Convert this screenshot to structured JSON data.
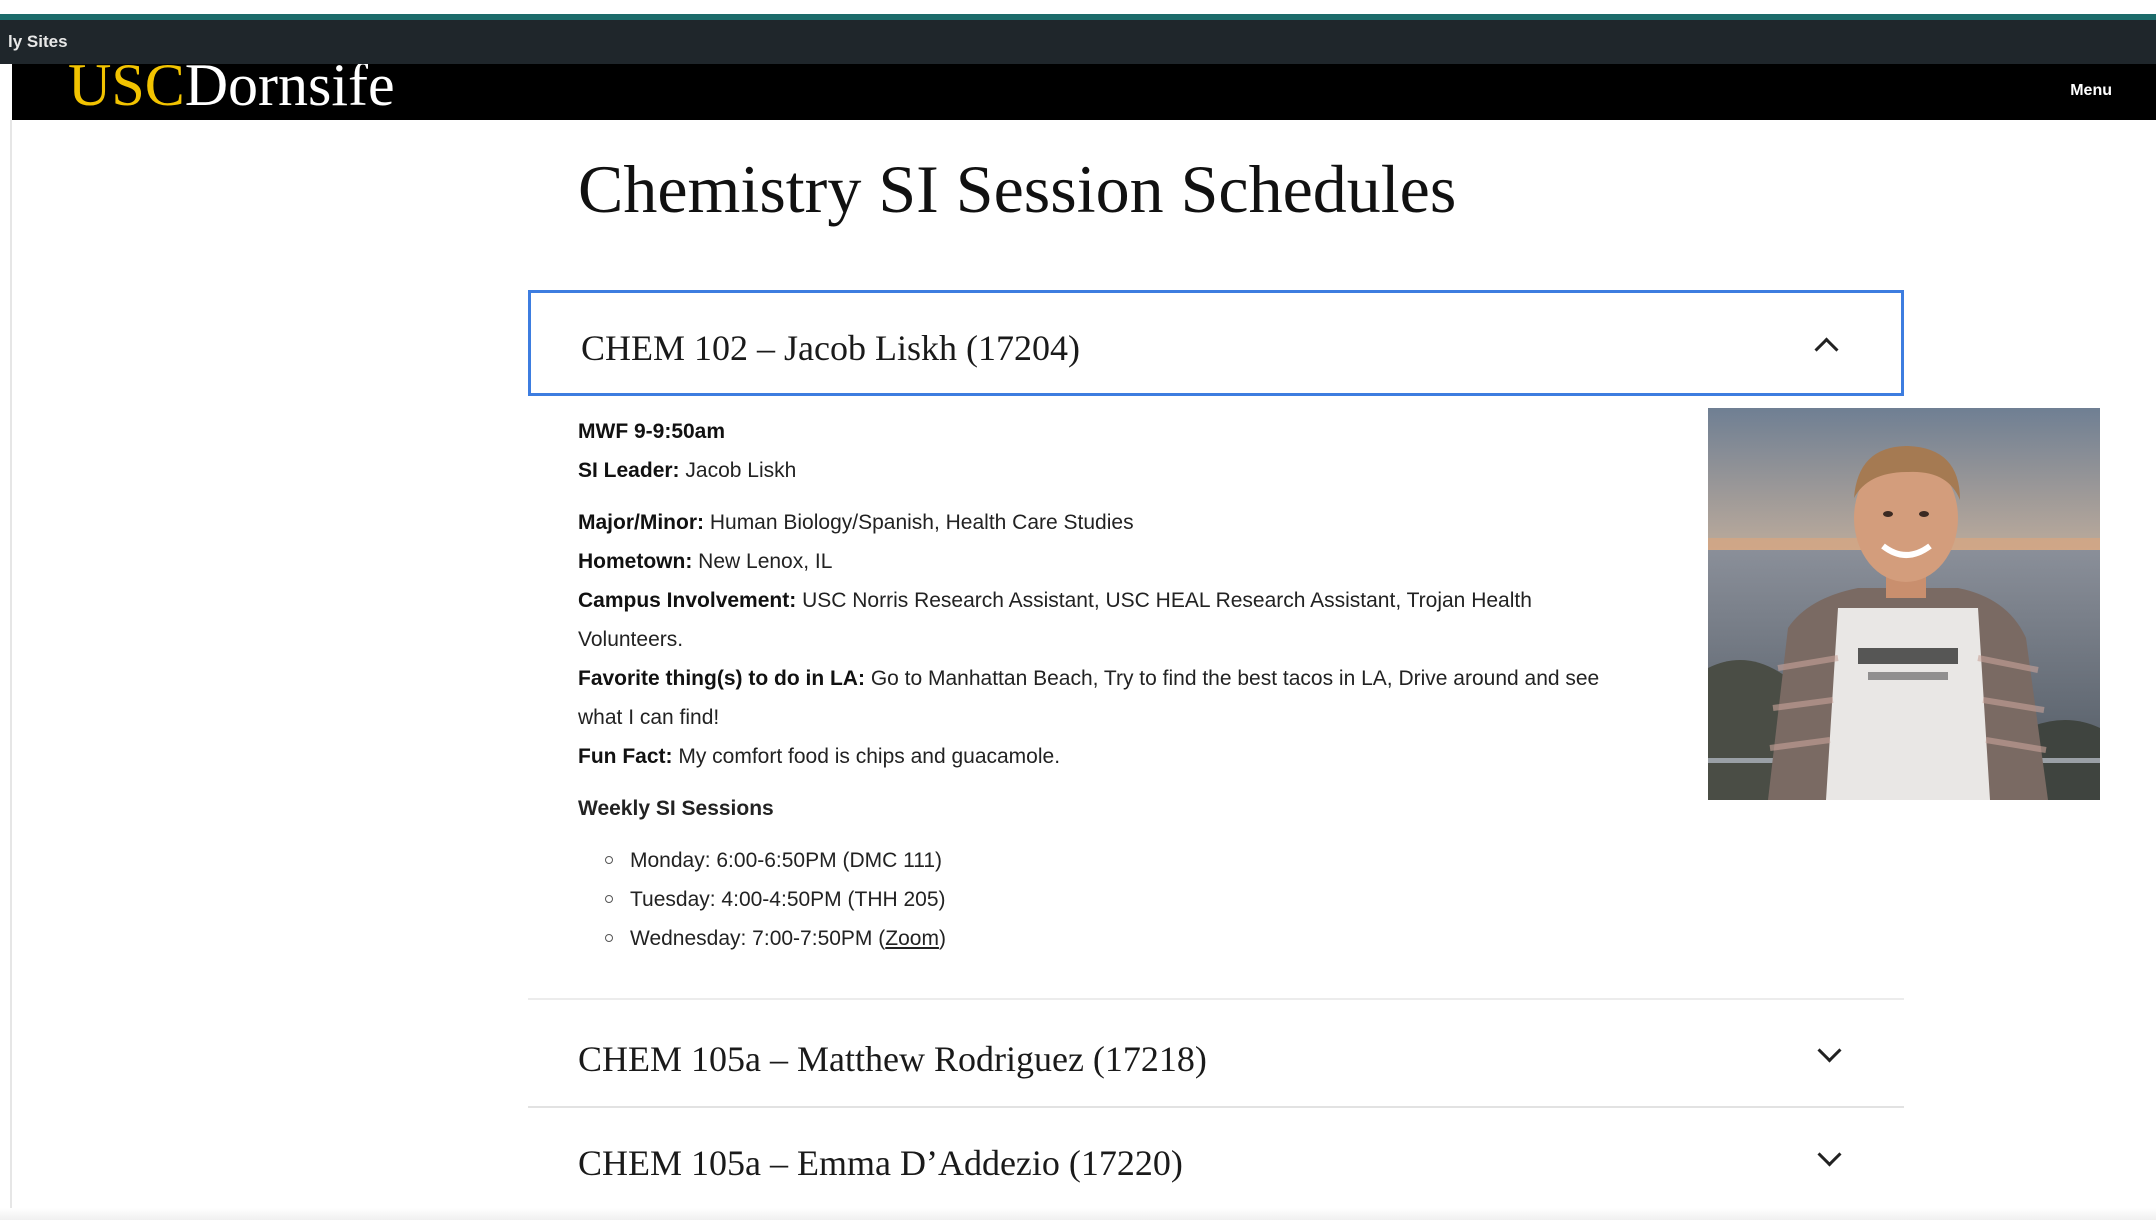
{
  "admin_bar": {
    "label": "ly Sites"
  },
  "header": {
    "logo_usc": "USC",
    "logo_dornsife": "Dornsife",
    "menu_label": "Menu"
  },
  "page": {
    "title": "Chemistry SI Session Schedules"
  },
  "accordion": [
    {
      "title": "CHEM 102 – Jacob Liskh (17204)",
      "expanded": true
    },
    {
      "title": "CHEM 105a – Matthew Rodriguez (17218)",
      "expanded": false
    },
    {
      "title": "CHEM 105a – Emma D’Addezio (17220)",
      "expanded": false
    }
  ],
  "leader": {
    "schedule": "MWF 9-9:50am",
    "si_leader_label": "SI Leader:",
    "si_leader": "Jacob Liskh",
    "major_label": "Major/Minor:",
    "major": "Human Biology/Spanish, Health Care Studies",
    "hometown_label": "Hometown:",
    "hometown": "New Lenox, IL",
    "campus_label": "Campus Involvement:",
    "campus": "USC Norris Research Assistant, USC HEAL Research Assistant, Trojan Health Volunteers.",
    "favorite_label": "Favorite thing(s) to do in LA:",
    "favorite": "Go to Manhattan Beach, Try to find the best tacos in LA, Drive around and see what I can find!",
    "funfact_label": "Fun Fact:",
    "funfact": "My comfort food is chips and guacamole.",
    "sessions_title": "Weekly SI Sessions",
    "sessions": [
      {
        "text": "Monday: 6:00-6:50PM (DMC 111)"
      },
      {
        "text": "Tuesday: 4:00-4:50PM (THH 205)"
      },
      {
        "text_before": "Wednesday: 7:00-7:50PM (",
        "link": "Zoom",
        "text_after": ")"
      }
    ]
  },
  "colors": {
    "accent_border": "#3d7de0",
    "logo_gold": "#f2c300",
    "header_bg": "#000000",
    "admin_bg": "#1f262b",
    "top_line": "#1c6b6a"
  },
  "icons": {
    "expanded": "chevron-up-icon",
    "collapsed": "chevron-down-icon"
  }
}
